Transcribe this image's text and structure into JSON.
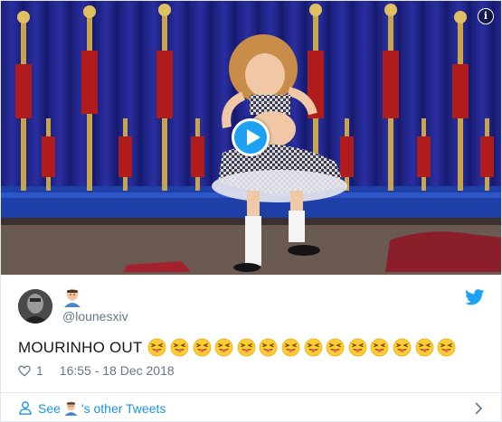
{
  "tweet": {
    "handle": "@lounesxiv",
    "text": "MOURINHO OUT",
    "emoji_count": 14,
    "emoji_icon": "face-with-tongue-squinting",
    "name_emoji_icon": "man-emoji",
    "likes": "1",
    "timestamp": "16:55 - 18 Dec 2018"
  },
  "footer": {
    "see_label": "See",
    "others_label": "'s other Tweets"
  },
  "icons": {
    "brand": "twitter-bird",
    "info": "info",
    "play": "play",
    "like": "heart-outline",
    "person": "person-outline",
    "chevron": "chevron-right"
  },
  "colors": {
    "brand": "#1da1f2",
    "link": "#1b95e0",
    "secondary_text": "#657786"
  }
}
